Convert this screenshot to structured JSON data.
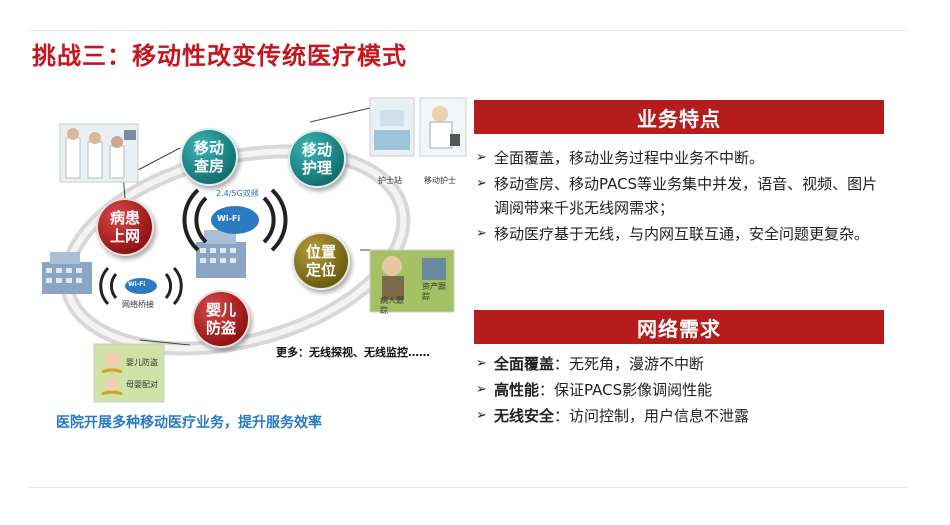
{
  "slide": {
    "title": "挑战三：移动性改变传统医疗模式"
  },
  "diagram": {
    "bubbles": {
      "mobile_rounds": "移动查房",
      "mobile_nursing": "移动护理",
      "patient_online": "病患上网",
      "location": "位置定位",
      "infant_antitheft": "婴儿防盗"
    },
    "wifi_freq": "2.4/5G双频",
    "wifi_badge": "Wi-Fi",
    "wifi_badge_small": "Wi-Fi",
    "bridge_label": "网络桥接",
    "nurse_station_label": "护士站",
    "mobile_nurse_label": "移动护士",
    "patient_track_label": "病人跟踪",
    "asset_track_label": "资产跟踪",
    "infant_label": "婴儿防盗",
    "mother_label": "母婴配对",
    "more_text": "更多：无线探视、无线监控……",
    "caption": "医院开展多种移动医疗业务，提升服务效率"
  },
  "business": {
    "header": "业务特点",
    "bullet_symbol": "➢",
    "items": [
      "全面覆盖，移动业务过程中业务不中断。",
      "移动查房、移动PACS等业务集中并发，语音、视频、图片调阅带来千兆无线网需求；",
      "移动医疗基于无线，与内网互联互通，安全问题更复杂。"
    ]
  },
  "network": {
    "header": "网络需求",
    "bullet_symbol": "➢",
    "items": [
      {
        "key": "全面覆盖",
        "text": "：无死角，漫游不中断"
      },
      {
        "key": "高性能",
        "text": "：保证PACS影像调阅性能"
      },
      {
        "key": "无线安全",
        "text": "：访问控制，用户信息不泄露"
      }
    ]
  },
  "colors": {
    "title_red": "#c4161c",
    "header_red": "#b71c1c",
    "caption_blue": "#2a7ac2",
    "teal": "#1a8a8a",
    "olive": "#8a7a20"
  }
}
